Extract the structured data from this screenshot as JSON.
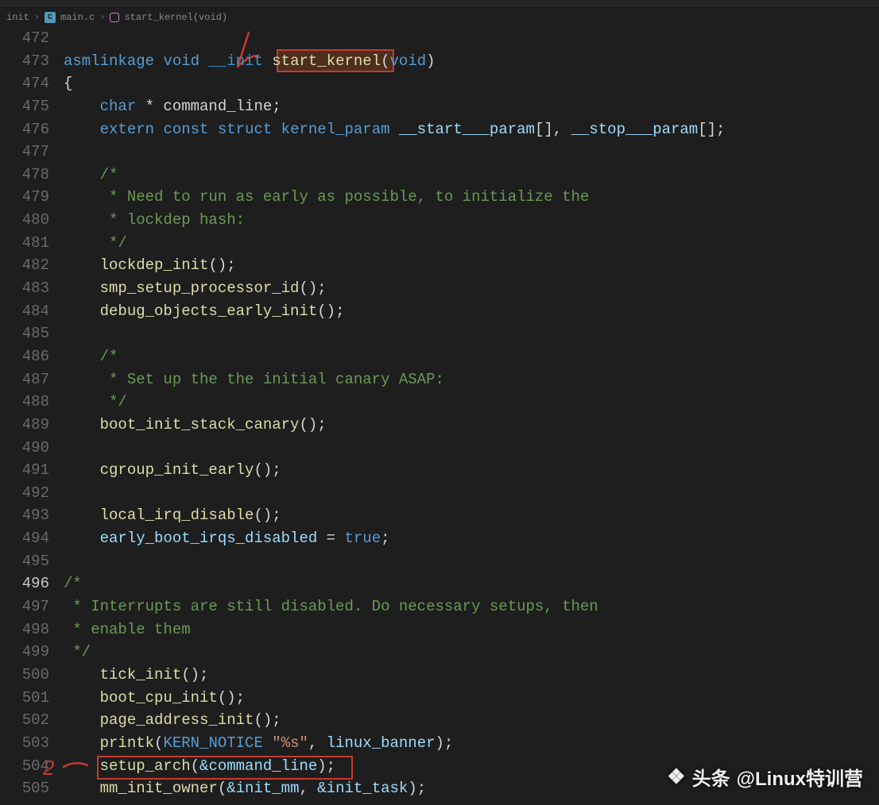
{
  "breadcrumb": {
    "seg0": "init",
    "seg1": "main.c",
    "seg2": "start_kernel(void)"
  },
  "lines": {
    "start": 472,
    "active": 496
  },
  "code": {
    "l473_kw1": "asmlinkage",
    "l473_kw2": "void",
    "l473_kw3": "__init",
    "l473_fn": "start_kernel",
    "l473_arg": "void",
    "l474": "{",
    "l475_kw": "char",
    "l475_rest": " * command_line;",
    "l476_kw1": "extern",
    "l476_kw2": "const",
    "l476_kw3": "struct",
    "l476_type": " kernel_param",
    "l476_v1": " __start___param",
    "l476_br": "[]",
    "l476_c": ", ",
    "l476_v2": "__stop___param",
    "l478_c": "/*",
    "l479_c": " * Need to run as early as possible, to initialize the",
    "l480_c": " * lockdep hash:",
    "l481_c": " */",
    "l482_fn": "lockdep_init",
    "l483_fn": "smp_setup_processor_id",
    "l484_fn": "debug_objects_early_init",
    "l486_c": "/*",
    "l487_c": " * Set up the the initial canary ASAP:",
    "l488_c": " */",
    "l489_fn": "boot_init_stack_canary",
    "l491_fn": "cgroup_init_early",
    "l493_fn": "local_irq_disable",
    "l494_v": "early_boot_irqs_disabled",
    "l494_b": "true",
    "l496_c": "/*",
    "l497_c": " * Interrupts are still disabled. Do necessary setups, then",
    "l498_c": " * enable them",
    "l499_c": " */",
    "l500_fn": "tick_init",
    "l501_fn": "boot_cpu_init",
    "l502_fn": "page_address_init",
    "l503_fn": "printk",
    "l503_m": "KERN_NOTICE",
    "l503_s": "\"%s\"",
    "l503_v": "linux_banner",
    "l504_fn": "setup_arch",
    "l504_arg": "&command_line",
    "l505_fn": "mm_init_owner",
    "l505_a1": "&init_mm",
    "l505_a2": "&init_task"
  },
  "annotations": {
    "mark1": "1",
    "mark2": "2、"
  },
  "watermark": {
    "prefix": "头条",
    "handle": "@Linux特训营"
  }
}
